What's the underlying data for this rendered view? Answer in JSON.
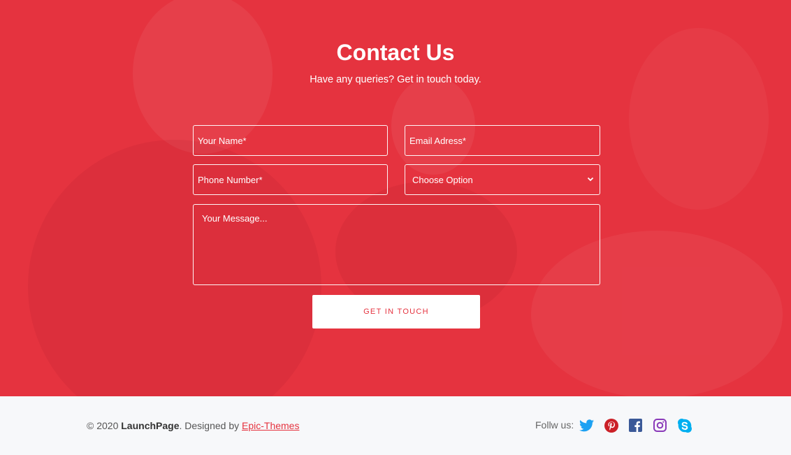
{
  "contact": {
    "title": "Contact Us",
    "subtitle": "Have any queries? Get in touch today.",
    "name_placeholder": "Your Name*",
    "email_placeholder": "Email Adress*",
    "phone_placeholder": "Phone Number*",
    "option_selected": "Choose Option",
    "message_placeholder": "Your Message...",
    "submit_label": "GET IN TOUCH"
  },
  "footer": {
    "copy_prefix": "© 2020 ",
    "brand": "LaunchPage",
    "designed_text": ". Designed by ",
    "designer": "Epic-Themes",
    "follow_label": "Follw us:"
  },
  "social": {
    "twitter_icon": "twitter-icon",
    "pinterest_icon": "pinterest-icon",
    "facebook_icon": "facebook-icon",
    "instagram_icon": "instagram-icon",
    "skype_icon": "skype-icon"
  },
  "colors": {
    "accent": "#e5333f",
    "footer_bg": "#f7f8fa"
  }
}
